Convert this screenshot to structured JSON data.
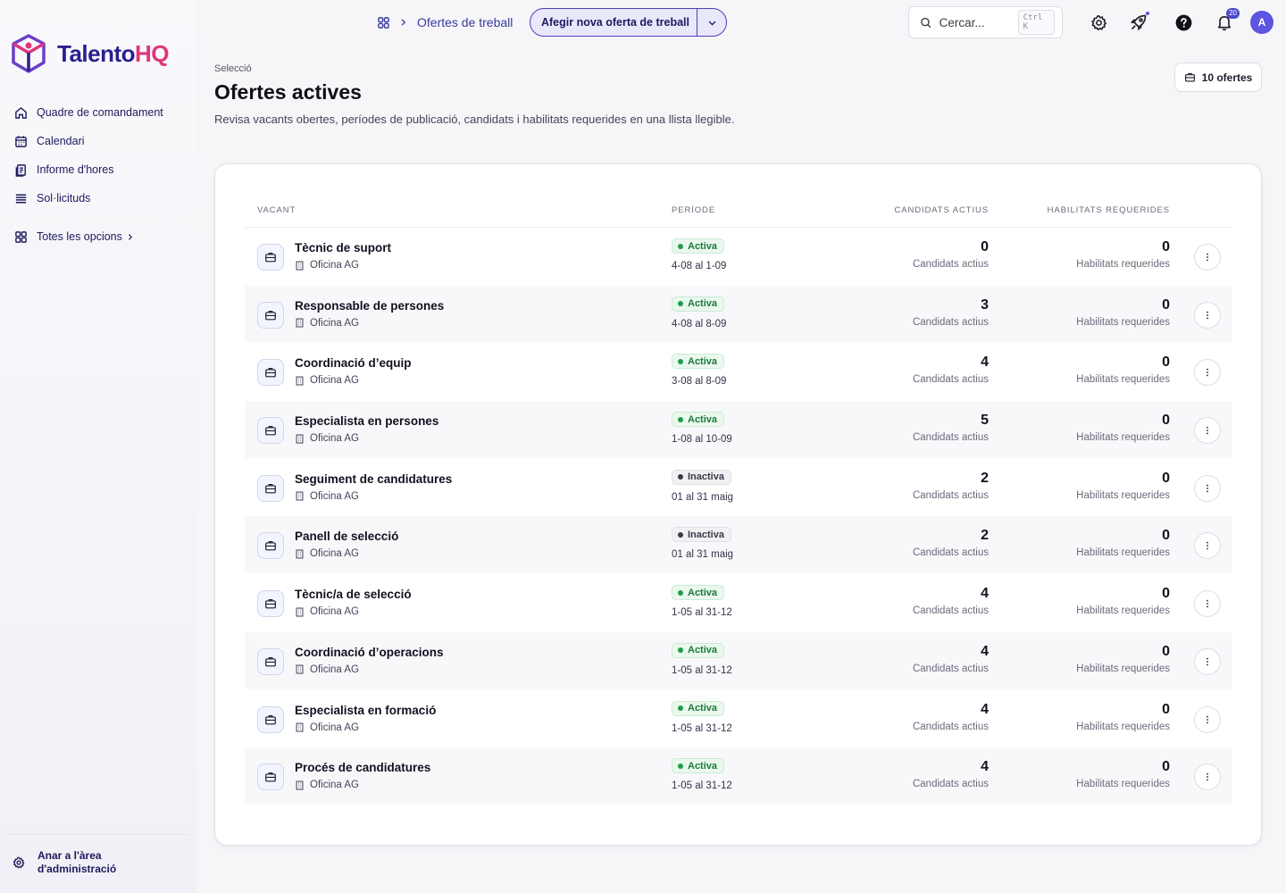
{
  "brand": {
    "name_part1": "Talento",
    "name_part2": "HQ",
    "primary": "#2b1f8c",
    "accent": "#e2347a"
  },
  "sidebar": {
    "items": [
      {
        "label": "Quadre de comandament",
        "icon": "home-icon"
      },
      {
        "label": "Calendari",
        "icon": "calendar-icon"
      },
      {
        "label": "Informe d'hores",
        "icon": "report-icon"
      },
      {
        "label": "Sol·licituds",
        "icon": "list-icon"
      }
    ],
    "all_options": "Totes les opcions",
    "admin_link": "Anar a l'àrea d'administració"
  },
  "topbar": {
    "breadcrumb": "Ofertes de treball",
    "add_button": "Afegir nova oferta de treball",
    "search_placeholder": "Cercar...",
    "search_shortcut": "Ctrl K",
    "notifications_count": "20",
    "avatar_initial": "A"
  },
  "header": {
    "eyebrow": "Selecció",
    "title": "Ofertes actives",
    "description": "Revisa vacants obertes, períodes de publicació, candidats i habilitats requerides en una llista llegible.",
    "count_label": "10 ofertes"
  },
  "table": {
    "columns": [
      "Vacant",
      "Període",
      "Candidats actius",
      "Habilitats requerides"
    ],
    "candidates_label": "Candidats actius",
    "skills_label": "Habilitats requerides",
    "rows": [
      {
        "title": "Tècnic de suport",
        "office": "Oficina AG",
        "status": "Activa",
        "active": true,
        "period": "4-08 al 1-09",
        "candidates": "0",
        "skills": "0"
      },
      {
        "title": "Responsable de persones",
        "office": "Oficina AG",
        "status": "Activa",
        "active": true,
        "period": "4-08 al 8-09",
        "candidates": "3",
        "skills": "0"
      },
      {
        "title": "Coordinació d’equip",
        "office": "Oficina AG",
        "status": "Activa",
        "active": true,
        "period": "3-08 al 8-09",
        "candidates": "4",
        "skills": "0"
      },
      {
        "title": "Especialista en persones",
        "office": "Oficina AG",
        "status": "Activa",
        "active": true,
        "period": "1-08 al 10-09",
        "candidates": "5",
        "skills": "0"
      },
      {
        "title": "Seguiment de candidatures",
        "office": "Oficina AG",
        "status": "Inactiva",
        "active": false,
        "period": "01 al 31 maig",
        "candidates": "2",
        "skills": "0"
      },
      {
        "title": "Panell de selecció",
        "office": "Oficina AG",
        "status": "Inactiva",
        "active": false,
        "period": "01 al 31 maig",
        "candidates": "2",
        "skills": "0"
      },
      {
        "title": "Tècnic/a de selecció",
        "office": "Oficina AG",
        "status": "Activa",
        "active": true,
        "period": "1-05 al 31-12",
        "candidates": "4",
        "skills": "0"
      },
      {
        "title": "Coordinació d’operacions",
        "office": "Oficina AG",
        "status": "Activa",
        "active": true,
        "period": "1-05 al 31-12",
        "candidates": "4",
        "skills": "0"
      },
      {
        "title": "Especialista en formació",
        "office": "Oficina AG",
        "status": "Activa",
        "active": true,
        "period": "1-05 al 31-12",
        "candidates": "4",
        "skills": "0"
      },
      {
        "title": "Procés de candidatures",
        "office": "Oficina AG",
        "status": "Activa",
        "active": true,
        "period": "1-05 al 31-12",
        "candidates": "4",
        "skills": "0"
      }
    ]
  }
}
